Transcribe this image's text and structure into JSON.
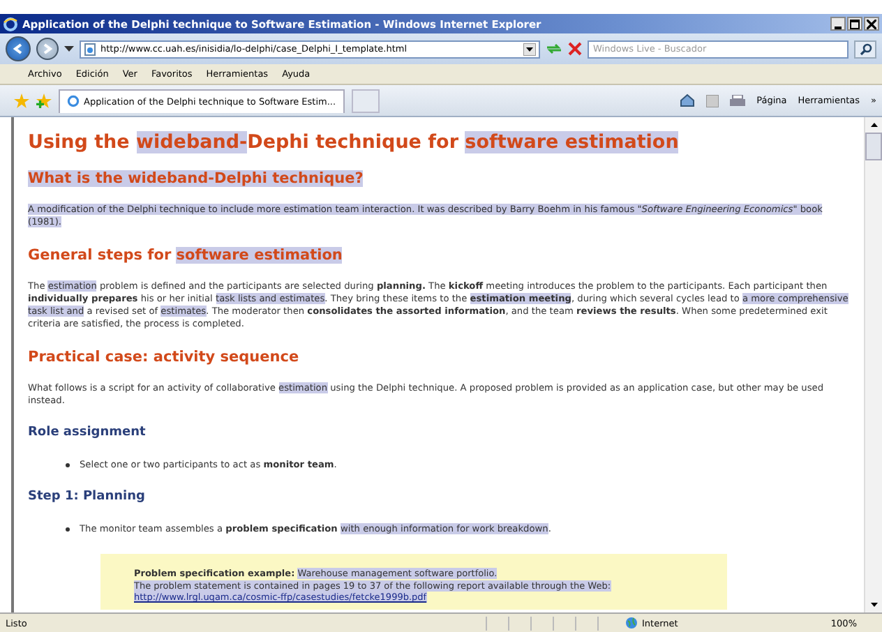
{
  "window": {
    "title": "Application of the Delphi technique to Software Estimation - Windows Internet Explorer"
  },
  "address_bar": {
    "url": "http://www.cc.uah.es/inisidia/lo-delphi/case_Delphi_I_template.html"
  },
  "search": {
    "placeholder": "Windows Live - Buscador"
  },
  "menu": [
    "Archivo",
    "Edición",
    "Ver",
    "Favoritos",
    "Herramientas",
    "Ayuda"
  ],
  "tabs": [
    {
      "label": "Application of the Delphi technique to Software Estim...",
      "selected": true
    }
  ],
  "command_bar": [
    "Página",
    "Herramientas",
    "»"
  ],
  "content": [
    {
      "kind": "h1",
      "segments": [
        {
          "text": "Using the ",
          "highlighted": false
        },
        {
          "text": "wideband-",
          "highlighted": true
        },
        {
          "text": "Dephi technique for ",
          "highlighted": false
        },
        {
          "text": "software estimation",
          "highlighted": true
        }
      ]
    },
    {
      "kind": "h2",
      "segments": [
        {
          "text": "What is the wideband-Delphi technique?",
          "highlighted": true
        }
      ]
    },
    {
      "kind": "p",
      "segments": [
        {
          "text": "A modification of the Delphi technique to include more estimation team interaction. It was described by Barry Boehm in his famous \"*Software Engineering Economics*\" book (1981).",
          "highlighted": true
        }
      ]
    },
    {
      "kind": "h2",
      "segments": [
        {
          "text": "General steps for ",
          "highlighted": false
        },
        {
          "text": "software estimation",
          "highlighted": true
        }
      ]
    },
    {
      "kind": "p",
      "segments": [
        {
          "text": "The ",
          "highlighted": false
        },
        {
          "text": "estimation",
          "highlighted": true
        },
        {
          "text": " problem is defined and the participants are selected during **planning.** The **kickoff** meeting introduces the problem to the participants. Each participant then **individually prepares** his or her initial ",
          "highlighted": false
        },
        {
          "text": "task lists and estimates",
          "highlighted": true
        },
        {
          "text": ". They bring these items to the ",
          "highlighted": false
        },
        {
          "text": "**estimation meeting**",
          "highlighted": true
        },
        {
          "text": ", during which several cycles lead to ",
          "highlighted": false
        },
        {
          "text": "a more comprehensive task list and",
          "highlighted": true
        },
        {
          "text": " a revised set of ",
          "highlighted": false
        },
        {
          "text": "estimates",
          "highlighted": true
        },
        {
          "text": ". The moderator then **consolidates the assorted information**, and the team **reviews the results**. When some predetermined exit criteria are satisfied, the process is completed.",
          "highlighted": false
        }
      ]
    },
    {
      "kind": "h2",
      "segments": [
        {
          "text": "Practical case: activity sequence",
          "highlighted": false
        }
      ]
    },
    {
      "kind": "p",
      "segments": [
        {
          "text": "What follows is a script for an activity of collaborative ",
          "highlighted": false
        },
        {
          "text": "estimation",
          "highlighted": true
        },
        {
          "text": " using the Delphi technique. A proposed problem is provided as an application case, but other may be used instead.",
          "highlighted": false
        }
      ]
    },
    {
      "kind": "h3",
      "segments": [
        {
          "text": "Role assignment",
          "highlighted": false
        }
      ]
    },
    {
      "kind": "bullet",
      "segments": [
        {
          "text": "Select one or two participants to act as **monitor team**.",
          "highlighted": false
        }
      ]
    },
    {
      "kind": "h3",
      "segments": [
        {
          "text": "Step 1: Planning",
          "highlighted": false
        }
      ]
    },
    {
      "kind": "bullet",
      "segments": [
        {
          "text": "The monitor team assembles a **problem specification** ",
          "highlighted": false
        },
        {
          "text": "with enough information for work breakdown",
          "highlighted": true
        },
        {
          "text": ".",
          "highlighted": false
        }
      ]
    },
    {
      "kind": "note",
      "lines": [
        [
          {
            "text": "**Problem specification example:** ",
            "highlighted": false
          },
          {
            "text": "Warehouse management software portfolio.",
            "highlighted": true
          }
        ],
        [
          {
            "text": "The problem statement is contained in pages 19 to 37 of the following report available through the Web:",
            "highlighted": true
          }
        ]
      ],
      "link": {
        "text": "http://www.lrgl.uqam.ca/cosmic-ffp/casestudies/fetcke1999b.pdf",
        "highlighted": true
      }
    }
  ],
  "status_bar": {
    "text": "Listo",
    "zone": "Internet",
    "zoom": "100%"
  }
}
